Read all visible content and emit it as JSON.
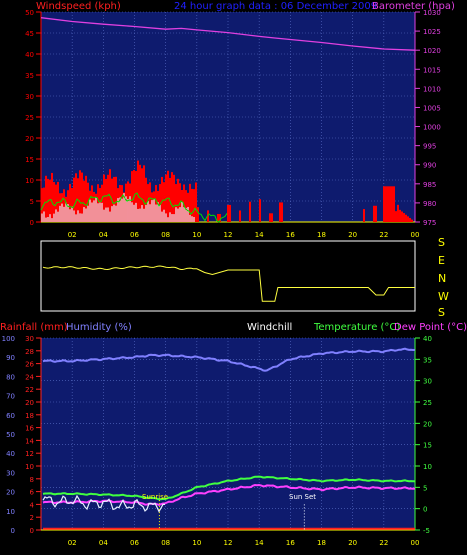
{
  "header": {
    "wind_label": "Windspeed (kph)",
    "title": "24 hour graph data : 06 December 2009",
    "baro_label": "Barometer (hpa)"
  },
  "wind_dir_letters": [
    "S",
    "E",
    "N",
    "W",
    "S"
  ],
  "lower_header": {
    "rain_label": "Rainfall (mm)",
    "humidity_label": "Humidity (%)",
    "windchill_label": "Windchill",
    "temp_label": "Temperature (°C)",
    "dew_label": "Dew Point (°C)"
  },
  "annotations": {
    "sunrise": "Sunrise",
    "sunset": "Sun Set"
  },
  "colors": {
    "bg": "#000000",
    "plot_bg": "#0e1b6e",
    "grid": "#5a6fc8",
    "wind_red": "#ff0000",
    "gust_green": "#00e000",
    "wind_white": "#e8f0ff",
    "baro_magenta": "#e040e0",
    "winddir_yellow": "#ffff40",
    "humidity_blue": "#8080ff",
    "temp_green": "#40ff40",
    "dew_magenta": "#ff40ff",
    "rain_red": "#ff2020",
    "text_white": "#ffffff",
    "text_yellow": "#ffff00"
  },
  "chart_data": [
    {
      "type": "area",
      "name": "wind",
      "title": "",
      "x_ticks": [
        "02",
        "04",
        "06",
        "08",
        "10",
        "12",
        "14",
        "16",
        "18",
        "20",
        "22",
        "00"
      ],
      "left_axis": {
        "label": "Windspeed (kph)",
        "ylim": [
          0,
          50
        ],
        "ticks": [
          0,
          5,
          10,
          15,
          20,
          25,
          30,
          35,
          40,
          45,
          50
        ]
      },
      "right_axis": {
        "label": "Barometer (hpa)",
        "ylim": [
          975,
          1030
        ],
        "ticks": [
          975,
          980,
          985,
          990,
          995,
          1000,
          1005,
          1010,
          1015,
          1020,
          1025,
          1030
        ]
      },
      "series": [
        {
          "name": "Barometer (hpa)",
          "axis": "right",
          "x": [
            0,
            2,
            4,
            6,
            8,
            9,
            10,
            12,
            14,
            15,
            16,
            18,
            20,
            22,
            24
          ],
          "values": [
            1028.5,
            1027.5,
            1026.8,
            1026.2,
            1025.5,
            1025.7,
            1025.3,
            1024.6,
            1023.6,
            1023.2,
            1022.8,
            1022.0,
            1021.1,
            1020.3,
            1020.0
          ]
        },
        {
          "name": "Wind",
          "axis": "left",
          "x": [
            0,
            1,
            2,
            3,
            4,
            5,
            6,
            6.5,
            7,
            8,
            9,
            10,
            10.5,
            11,
            12,
            13,
            14,
            15,
            16,
            20,
            21,
            22,
            22.5,
            23,
            24
          ],
          "values": [
            8,
            9,
            9,
            10,
            9,
            10,
            11,
            12,
            10,
            9,
            11,
            6,
            5,
            4,
            3,
            4,
            5,
            3,
            0,
            0,
            4,
            0,
            9,
            3,
            0
          ]
        },
        {
          "name": "Gust",
          "axis": "left",
          "x": [
            0,
            1,
            2,
            3,
            4,
            5,
            6,
            7,
            8,
            9,
            10,
            11,
            12,
            14,
            16,
            24
          ],
          "values": [
            4,
            5,
            4,
            5,
            6,
            5,
            6,
            5,
            5,
            4,
            2,
            1,
            1,
            1,
            0,
            0
          ]
        },
        {
          "name": "Average",
          "axis": "left",
          "x": [
            0,
            1,
            2,
            3,
            4,
            5,
            6,
            7,
            8,
            9,
            10,
            11,
            12,
            24
          ],
          "values": [
            2,
            3,
            3,
            4,
            4,
            5,
            5,
            4,
            3,
            3,
            1,
            0,
            0,
            0
          ]
        }
      ]
    },
    {
      "type": "line",
      "name": "wind_direction",
      "title": "",
      "y_categories": [
        "S",
        "E",
        "N",
        "W",
        "S"
      ],
      "series": [
        {
          "name": "Direction",
          "x": [
            0,
            2,
            4,
            6,
            8,
            9,
            10,
            10.5,
            11,
            12,
            14,
            14.2,
            15,
            15.2,
            16,
            21,
            21.5,
            22,
            22.3,
            24
          ],
          "values": [
            0.5,
            0.5,
            0.55,
            0.5,
            0.45,
            0.55,
            0.55,
            0.7,
            0.78,
            0.6,
            0.6,
            1.85,
            1.85,
            1.3,
            1.3,
            1.3,
            1.6,
            1.6,
            1.3,
            1.3
          ]
        }
      ]
    },
    {
      "type": "line",
      "name": "environment",
      "title": "",
      "x_ticks": [
        "02",
        "04",
        "06",
        "08",
        "10",
        "12",
        "14",
        "16",
        "18",
        "20",
        "22",
        "00"
      ],
      "left_axis_outer": {
        "label": "Humidity (%)",
        "ylim": [
          0,
          100
        ],
        "ticks": [
          0,
          10,
          20,
          30,
          40,
          50,
          60,
          70,
          80,
          90,
          100
        ]
      },
      "left_axis_inner": {
        "label": "Rainfall (mm)",
        "ylim": [
          0,
          30
        ],
        "ticks": [
          0,
          2,
          4,
          6,
          8,
          10,
          12,
          14,
          16,
          18,
          20,
          22,
          24,
          26,
          28,
          30
        ]
      },
      "right_axis": {
        "label": "Temperature (°C)",
        "ylim": [
          -5,
          40
        ],
        "ticks": [
          -5,
          0,
          5,
          10,
          15,
          20,
          25,
          30,
          35,
          40
        ]
      },
      "series": [
        {
          "name": "Humidity (%)",
          "axis": "left_outer",
          "x": [
            0,
            2,
            4,
            6,
            7,
            8,
            10,
            12,
            13,
            14,
            14.5,
            15,
            16,
            18,
            20,
            22,
            23,
            24
          ],
          "values": [
            88,
            88,
            89,
            90,
            91,
            91,
            90,
            88,
            86,
            84,
            83,
            85,
            89,
            92,
            93,
            93,
            94,
            94
          ]
        },
        {
          "name": "Temperature (°C)",
          "axis": "right",
          "x": [
            0,
            2,
            4,
            6,
            7,
            8,
            9,
            10,
            12,
            14,
            16,
            18,
            20,
            22,
            24
          ],
          "values": [
            3.5,
            3.5,
            3.3,
            3.0,
            2.5,
            2.2,
            3.5,
            5.0,
            6.5,
            7.5,
            7.0,
            6.5,
            6.8,
            6.5,
            6.5
          ]
        },
        {
          "name": "Dew Point (°C)",
          "axis": "right",
          "x": [
            0,
            2,
            4,
            6,
            7,
            8,
            9,
            10,
            12,
            14,
            16,
            18,
            20,
            22,
            24
          ],
          "values": [
            1.5,
            1.5,
            1.8,
            1.5,
            1.0,
            1.2,
            2.5,
            3.5,
            4.5,
            5.5,
            5.0,
            4.5,
            5.0,
            4.8,
            4.8
          ]
        },
        {
          "name": "Windchill",
          "axis": "right",
          "x": [
            0,
            1,
            2,
            3,
            4,
            5,
            6,
            7,
            8
          ],
          "values": [
            2.5,
            1.5,
            2.0,
            1.0,
            1.5,
            0.5,
            1.0,
            0.5,
            0.8
          ]
        },
        {
          "name": "Rainfall (mm)",
          "axis": "left_inner",
          "x": [
            0,
            24
          ],
          "values": [
            0.2,
            0.2
          ]
        }
      ]
    }
  ]
}
